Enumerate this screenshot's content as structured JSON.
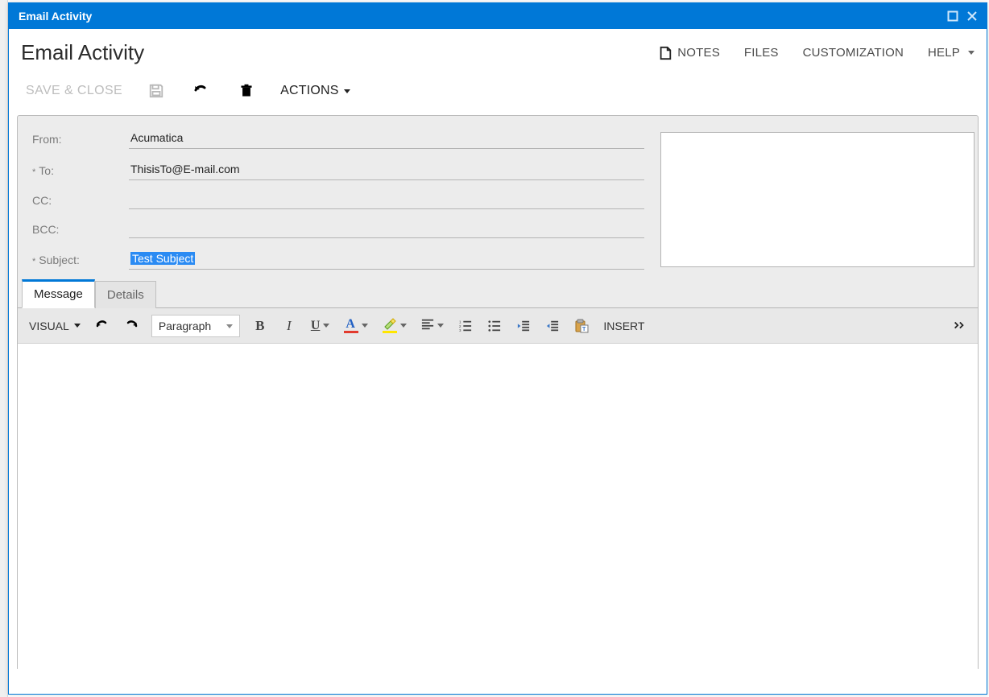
{
  "window": {
    "title": "Email Activity"
  },
  "page": {
    "title": "Email Activity"
  },
  "rightLinks": {
    "notes": "NOTES",
    "files": "FILES",
    "customization": "CUSTOMIZATION",
    "help": "HELP"
  },
  "toolbar": {
    "save_close": "SAVE & CLOSE",
    "actions": "ACTIONS"
  },
  "form": {
    "labels": {
      "from": "From:",
      "to": "To:",
      "cc": "CC:",
      "bcc": "BCC:",
      "subject": "Subject:"
    },
    "values": {
      "from": "Acumatica",
      "to": "ThisisTo@E-mail.com",
      "cc": "",
      "bcc": "",
      "subject": "Test Subject"
    }
  },
  "tabs": {
    "message": "Message",
    "details": "Details"
  },
  "editor": {
    "visual": "VISUAL",
    "paragraph": "Paragraph",
    "insert": "INSERT"
  }
}
